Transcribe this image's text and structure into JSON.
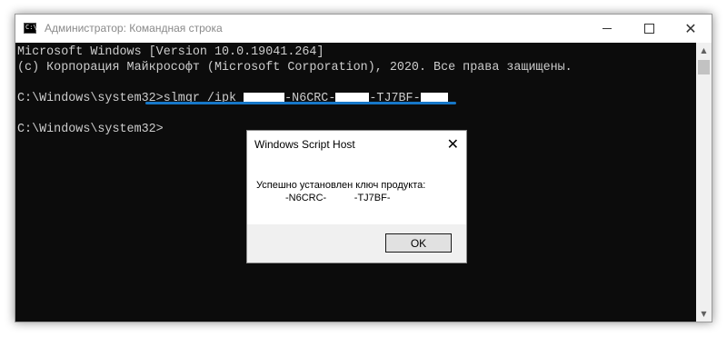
{
  "window": {
    "title": "Администратор: Командная строка",
    "icon_text": "C:\\"
  },
  "console": {
    "lines": [
      "Microsoft Windows [Version 10.0.19041.264]",
      "(с) Корпорация Майкрософт (Microsoft Corporation), 2020. Все права защищены."
    ],
    "command_prompt": "C:\\Windows\\system32>",
    "command_text": "slmgr /ipk ",
    "key_part_2": "-N6CRC-",
    "key_part_4": "-TJ7BF-",
    "prompt_2": "C:\\Windows\\system32>"
  },
  "dialog": {
    "title": "Windows Script Host",
    "message": "Успешно установлен ключ продукта:",
    "key_line": "-N6CRC-          -TJ7BF-",
    "ok_label": "OK"
  },
  "colors": {
    "console_bg": "#0c0c0c",
    "console_text": "#cccccc",
    "highlight": "#1677c8"
  },
  "icons": [
    "cmd-icon",
    "minimize-icon",
    "maximize-icon",
    "close-icon",
    "scroll-up-icon",
    "scroll-down-icon",
    "dialog-close-icon"
  ]
}
